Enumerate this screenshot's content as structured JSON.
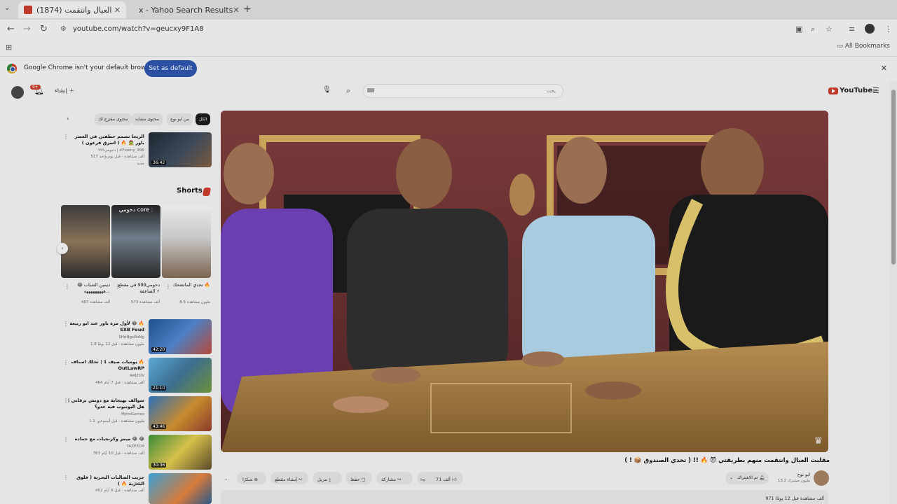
{
  "browser": {
    "tabs": [
      {
        "title": "(1874) مقلبت العيال وانتقمت",
        "active": true
      },
      {
        "title": "x - Yahoo Search Results",
        "active": false
      }
    ],
    "url": "youtube.com/watch?v=geucxy9F1A8",
    "all_bookmarks": "All Bookmarks",
    "default_browser_msg": "Google Chrome isn't your default browser",
    "set_default_label": "Set as default"
  },
  "masthead": {
    "notifications": "9+",
    "create_label": "إنشاء",
    "search_placeholder": "بحث",
    "logo_text": "YouTube",
    "logo_region": "SA"
  },
  "chips": [
    "الكل",
    "من ابو نوح",
    "محتوى مشابه",
    "محتوى مقترح لك"
  ],
  "video": {
    "title": "مقلبت العيال وانتقمت منهم بطريقتي 😈 🔥 !! ( تحدي الصندوق 📦 ! )",
    "channel": "ابو نوح",
    "subscribers": "13.2 مليون مشترك",
    "subscribe_label": "تم الاشتراك",
    "likes": "71 ألف",
    "share": "مشاركة",
    "save": "حفظ",
    "download": "تنزيل",
    "clip": "إنشاء مقطع",
    "thanks": "شكرًا",
    "views_line": "971 ألف مشاهدة  قبل 12 يومًا"
  },
  "sidebar_top": {
    "title": "الريحا تصمم حظفين في العصر باور 🧟 🔥 ( اسرق فرعون )",
    "channel": "دحومي٩٩٩ | d7oomy_999",
    "meta": "517 ألف مشاهدة · قبل يوم واحد",
    "badge": "جديد",
    "duration": "36:42"
  },
  "shorts": {
    "heading": "Shorts",
    "items": [
      {
        "title": "تحدي الماتضحك 🔥",
        "views": "8.5 مليون مشاهدة"
      },
      {
        "title": "دحومي999 في مقطع الصاعقة ⚡",
        "views": "573 ألف مشاهدة"
      },
      {
        "title": "ديمين الشباب 😂 هههههههههه...",
        "views": "487 ألف مشاهدة"
      }
    ],
    "overlay_text": "دحومي core :"
  },
  "sidebar_list": [
    {
      "title": "لأول مرة باور عند ابو ربيعة 😂 🔥 SXB Feud",
      "channel": "SHoNgxBoNg",
      "meta": "1.8 مليون مشاهدة · قبل 12 يومًا",
      "duration": "42:20"
    },
    {
      "title": "يوميات صيف 1 | تخلك استاف 🔥 OutLawRP",
      "channel": "RAIZOV",
      "meta": "464 ألف مشاهدة · قبل 7 أيام",
      "duration": "21:10"
    },
    {
      "title": "سوالف بهبجاية مع دوتش برقاني | هل اليوتيوب فيه عدو؟",
      "channel": "MjrmGames",
      "meta": "1.1 مليون مشاهدة · قبل أسبوعين",
      "duration": "43:46"
    },
    {
      "title": "ميمز وكرنجيات مع جماده 😂 😂",
      "channel": "YAZEEDX",
      "meta": "763 ألف مشاهدة · قبل 10 أيام",
      "duration": "30:36"
    },
    {
      "title": "جريت الصالبات البحرية ( فلوق البحرية 🔥 )",
      "channel": "F R S",
      "meta": "452 ألف مشاهدة · قبل 6 أيام",
      "duration": ""
    }
  ]
}
